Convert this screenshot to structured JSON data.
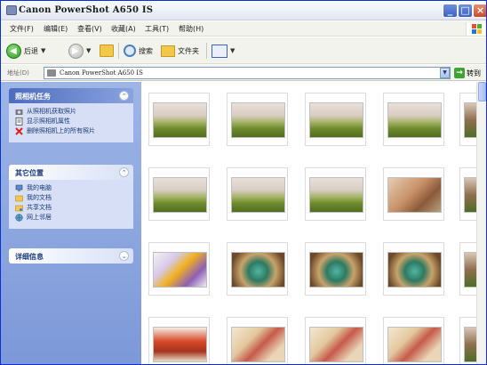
{
  "window": {
    "title": "Canon PowerShot A650 IS"
  },
  "menu": {
    "items": [
      {
        "label": "文件(F)"
      },
      {
        "label": "编辑(E)"
      },
      {
        "label": "查看(V)"
      },
      {
        "label": "收藏(A)"
      },
      {
        "label": "工具(T)"
      },
      {
        "label": "帮助(H)"
      }
    ]
  },
  "toolbar": {
    "back_label": "后退",
    "search_label": "搜索",
    "folders_label": "文件夹"
  },
  "address": {
    "label": "地址(D)",
    "value": "Canon PowerShot A650 IS",
    "go_label": "转到"
  },
  "sidebar": {
    "camera_tasks": {
      "title": "照相机任务",
      "items": [
        {
          "label": "从照相机获取照片",
          "icon": "camera-get-icon"
        },
        {
          "label": "显示照相机属性",
          "icon": "properties-icon"
        },
        {
          "label": "删除照相机上的所有照片",
          "icon": "delete-icon"
        }
      ]
    },
    "other_places": {
      "title": "其它位置",
      "items": [
        {
          "label": "我的电脑",
          "icon": "my-computer-icon"
        },
        {
          "label": "我的文档",
          "icon": "my-documents-icon"
        },
        {
          "label": "共享文档",
          "icon": "shared-documents-icon"
        },
        {
          "label": "网上邻居",
          "icon": "network-places-icon"
        }
      ]
    },
    "details": {
      "title": "详细信息"
    }
  },
  "photos": [
    {
      "theme": "figurines-field"
    },
    {
      "theme": "figurines-field"
    },
    {
      "theme": "figurines-field"
    },
    {
      "theme": "figurines-field"
    },
    {
      "theme": "partial"
    },
    {
      "theme": "figurines-field"
    },
    {
      "theme": "figurines-field"
    },
    {
      "theme": "figurines-field"
    },
    {
      "theme": "figurines-clay"
    },
    {
      "theme": "partial"
    },
    {
      "theme": "toy-bird"
    },
    {
      "theme": "mask-face"
    },
    {
      "theme": "mask-face"
    },
    {
      "theme": "mask-face"
    },
    {
      "theme": "partial"
    },
    {
      "theme": "red-toy"
    },
    {
      "theme": "drawings"
    },
    {
      "theme": "drawings"
    },
    {
      "theme": "drawings"
    },
    {
      "theme": "partial"
    }
  ],
  "colors": {
    "taskpane_bg": "#7d98d8",
    "panel_body": "#d6dff5",
    "link_text": "#1a3a7a",
    "titlebar_blue": "#3a62c8"
  }
}
